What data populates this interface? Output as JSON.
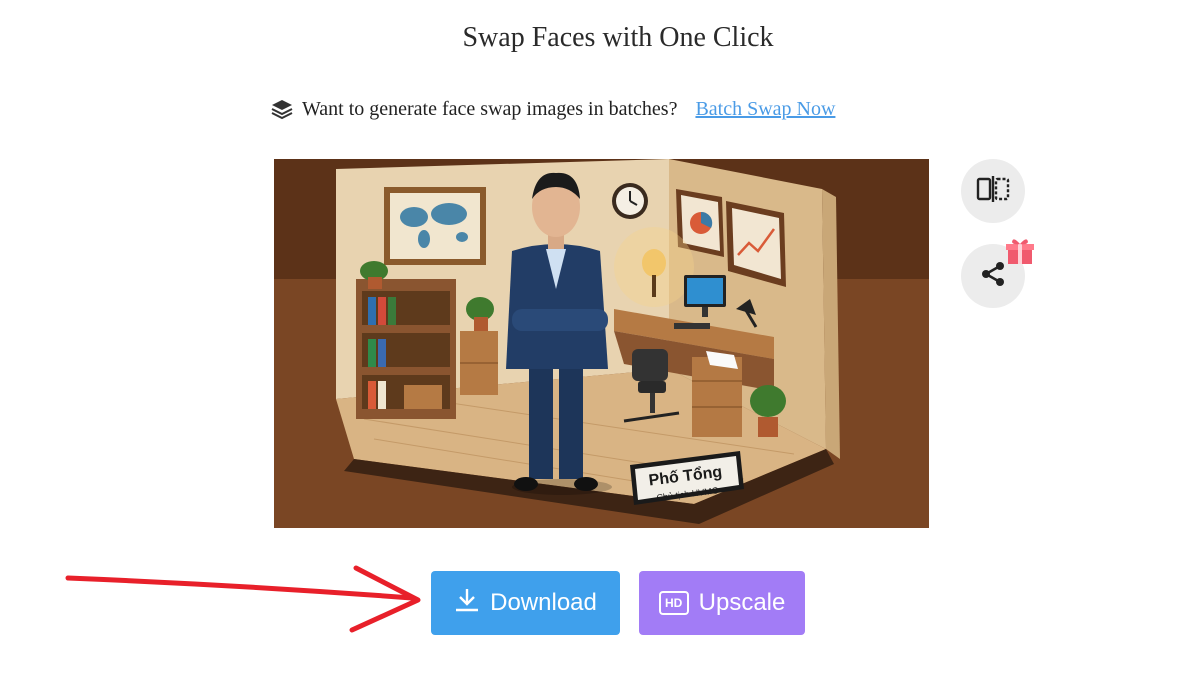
{
  "header": {
    "title": "Swap Faces with One Click"
  },
  "promo": {
    "text": "Want to generate face swap images in batches?",
    "link_label": "Batch Swap Now",
    "icon": "layers-icon"
  },
  "result_image": {
    "nameplate_name": "Phố Tổng",
    "nameplate_title": "Chủ tịch HVMO"
  },
  "side_actions": {
    "compare_icon": "compare-icon",
    "share_icon": "share-icon",
    "gift_icon": "gift-icon"
  },
  "actions": {
    "download_label": "Download",
    "upscale_label": "Upscale",
    "upscale_badge": "HD"
  },
  "colors": {
    "download": "#3fa0ec",
    "upscale": "#a27cf6",
    "link": "#4a9be6",
    "arrow": "#e8202a"
  }
}
